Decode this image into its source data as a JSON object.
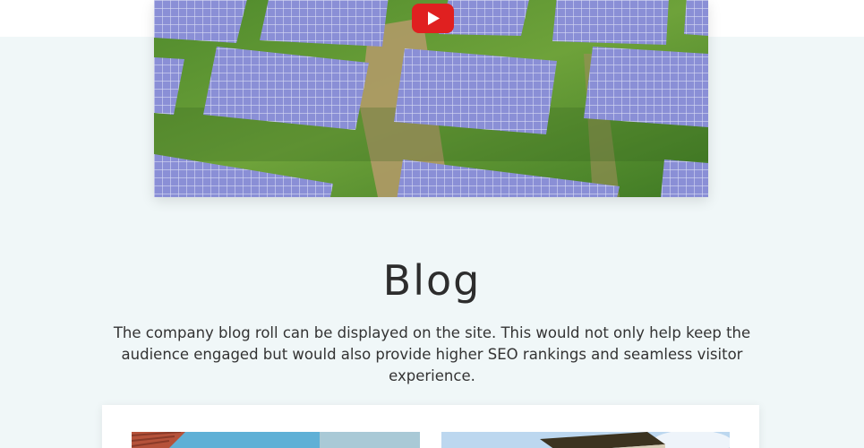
{
  "video": {
    "thumbnail_icon": "solar-panels-image",
    "play_icon": "youtube-play-icon",
    "play_color": "#e02020"
  },
  "blog": {
    "title": "Blog",
    "description": "The company blog roll can be displayed on the site. This would not only help keep the audience engaged but would also provide higher SEO rankings and seamless visitor experience."
  },
  "cards": {
    "thumb_1_icon": "building-photo",
    "thumb_2_icon": "building-photo"
  }
}
